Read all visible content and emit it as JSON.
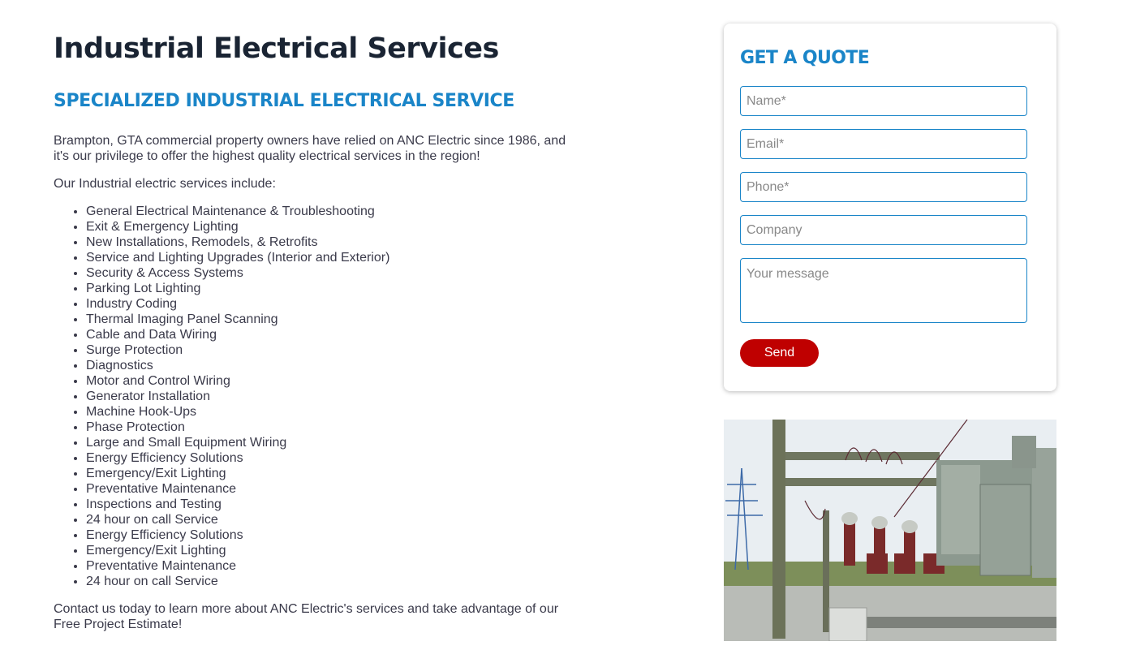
{
  "main": {
    "title": "Industrial Electrical Services",
    "subtitle": "SPECIALIZED INDUSTRIAL ELECTRICAL SERVICE",
    "intro": "Brampton, GTA commercial property owners have relied on ANC Electric since 1986, and it's our privilege to offer the highest quality electrical services in the region!",
    "services_heading": "Our Industrial electric services include:",
    "services": [
      "General Electrical Maintenance & Troubleshooting",
      "Exit & Emergency Lighting",
      "New Installations, Remodels, & Retrofits",
      "Service and Lighting Upgrades (Interior and Exterior)",
      "Security & Access Systems",
      "Parking Lot Lighting",
      "Industry Coding",
      "Thermal Imaging Panel Scanning",
      "Cable and Data Wiring",
      "Surge Protection",
      "Diagnostics",
      "Motor and Control Wiring",
      "Generator Installation",
      "Machine Hook-Ups",
      "Phase Protection",
      "Large and Small Equipment Wiring",
      "Energy Efficiency Solutions",
      "Emergency/Exit Lighting",
      "Preventative Maintenance",
      "Inspections and Testing",
      "24 hour on call Service",
      "Energy Efficiency Solutions",
      "Emergency/Exit Lighting",
      "Preventative Maintenance",
      "24 hour on call Service"
    ],
    "outro": "Contact us today to learn more about ANC Electric's services and take advantage of our Free Project Estimate!"
  },
  "quote_form": {
    "title": "GET A QUOTE",
    "name_placeholder": "Name*",
    "email_placeholder": "Email*",
    "phone_placeholder": "Phone*",
    "company_placeholder": "Company",
    "message_placeholder": "Your message",
    "name_value": "",
    "email_value": "",
    "phone_value": "",
    "company_value": "",
    "message_value": "",
    "send_label": "Send"
  },
  "image": {
    "alt": "Electrical substation with transformer and insulators"
  },
  "colors": {
    "accent_blue": "#1a85c8",
    "title_dark": "#1a2433",
    "send_red": "#bf0000"
  }
}
